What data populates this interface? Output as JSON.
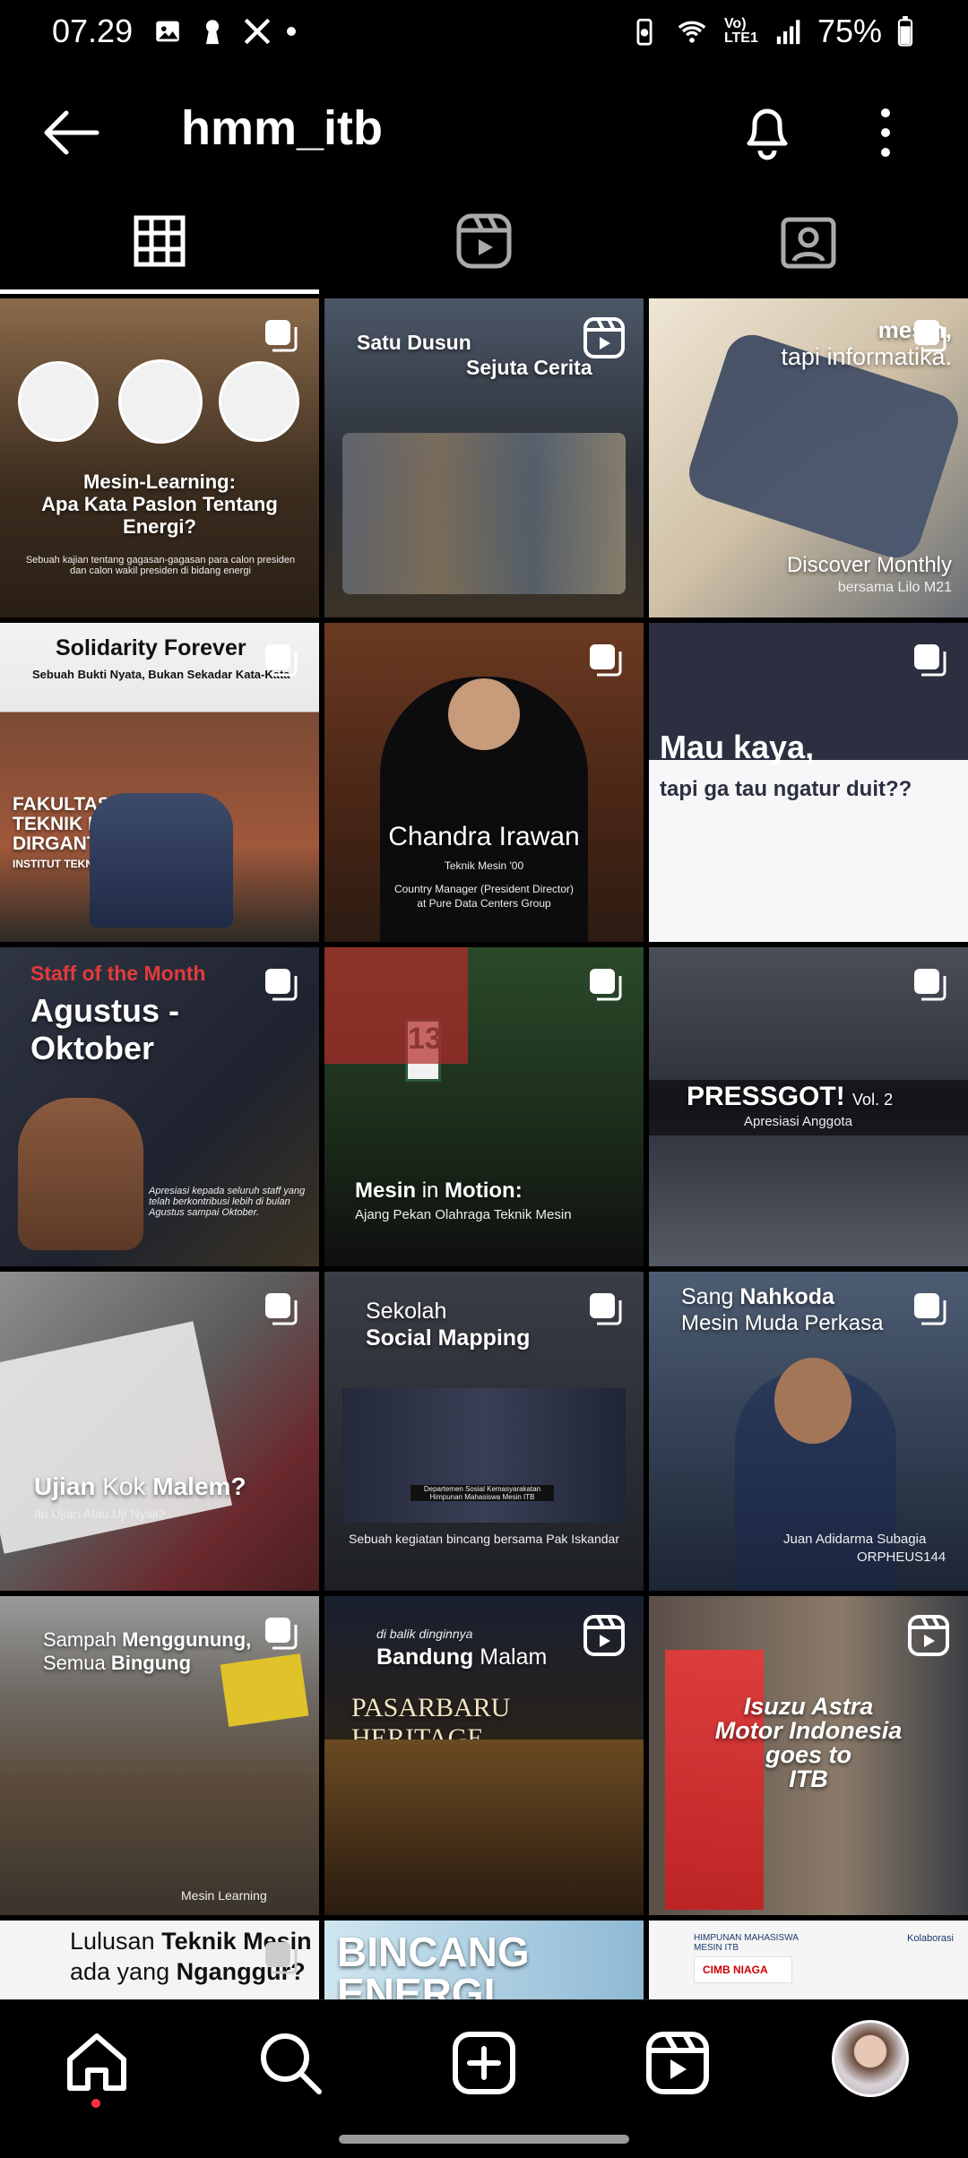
{
  "status_bar": {
    "time": "07.29",
    "battery": "75%",
    "network": "Vo) LTE1"
  },
  "header": {
    "title": "hmm_itb"
  },
  "tabs": [
    {
      "name": "posts-grid"
    },
    {
      "name": "reels"
    },
    {
      "name": "tagged"
    }
  ],
  "posts": [
    {
      "line1": "Mesin-Learning:",
      "line2": "Apa Kata Paslon Tentang",
      "line3": "Energi?",
      "caption": "Sebuah kajian tentang gagasan-gagasan para calon presiden dan calon wakil presiden di bidang energi"
    },
    {
      "line1": "Satu Dusun",
      "line2": "Sejuta Cerita"
    },
    {
      "line1": "mesin,",
      "line2": "tapi informatika.",
      "line3": "Discover Monthly",
      "line4": "bersama Lilo M21"
    },
    {
      "line1": "Solidarity Forever",
      "line2": "Sebuah Bukti Nyata, Bukan Sekadar Kata-Kata",
      "line3": "FAKULTAS",
      "line4": "TEKNIK MESIN",
      "line5": "DIRGANTA",
      "line6": "INSTITUT TEKNOL"
    },
    {
      "line1": "Chandra Irawan",
      "line2": "Teknik Mesin '00",
      "line3": "Country Manager (President Director)",
      "line4": "at Pure Data Centers Group"
    },
    {
      "line1": "Mau kaya,",
      "line2": "tapi ga tau ngatur duit??"
    },
    {
      "line1": "Staff of the Month",
      "line2": "Agustus -",
      "line3": "Oktober",
      "line4": "Apresiasi kepada seluruh staff yang telah berkontribusi lebih di bulan Agustus sampai Oktober."
    },
    {
      "line1": "Mesin",
      "line1b": "in",
      "line1c": "Motion",
      "line2": "Ajang Pekan Olahraga Teknik Mesin"
    },
    {
      "line1": "PRESSGOT!",
      "line1b": "Vol. 2",
      "line2": "Apresiasi Anggota"
    },
    {
      "line1": "Ujian",
      "line1b": "Kok",
      "line1c": "Malem",
      "line2": "Itu Ujian Atau Uji Nyali?"
    },
    {
      "line1": "Sekolah",
      "line2": "Social Mapping",
      "line3": "Departemen Sosial Kemasyarakatan Himpunan Mahasiswa Mesin ITB",
      "line4": "Sebuah kegiatan bincang bersama Pak Iskandar"
    },
    {
      "line1": "Sang",
      "line1b": "Nahkoda",
      "line2": "Mesin Muda Perkasa",
      "line3": "Juan Adidarma Subagia",
      "line4": "ORPHEUS144"
    },
    {
      "line1": "Sampah",
      "line1b": "Menggunung,",
      "line2": "Semua",
      "line2b": "Bingung",
      "line3": "Mesin Learning"
    },
    {
      "line1": "di balik dinginnya",
      "line2": "Bandung",
      "line2b": "Malam",
      "line3": "PASARBARU HERITAGE"
    },
    {
      "line1": "Isuzu Astra",
      "line2": "Motor Indonesia",
      "line3": "goes to",
      "line4": "ITB"
    },
    {
      "line1": "Lulusan",
      "line1b": "Teknik Mesin",
      "line2": "ada yang",
      "line2b": "Nganggur?"
    },
    {
      "line1": "BINCANG",
      "line2": "ENERGI"
    },
    {
      "line1": "HIMPUNAN MAHASISWA MESIN ITB",
      "line2": "Kolaborasi",
      "line3": "CIMB NIAGA"
    }
  ],
  "nav": [
    "home",
    "search",
    "create",
    "reels",
    "profile"
  ]
}
